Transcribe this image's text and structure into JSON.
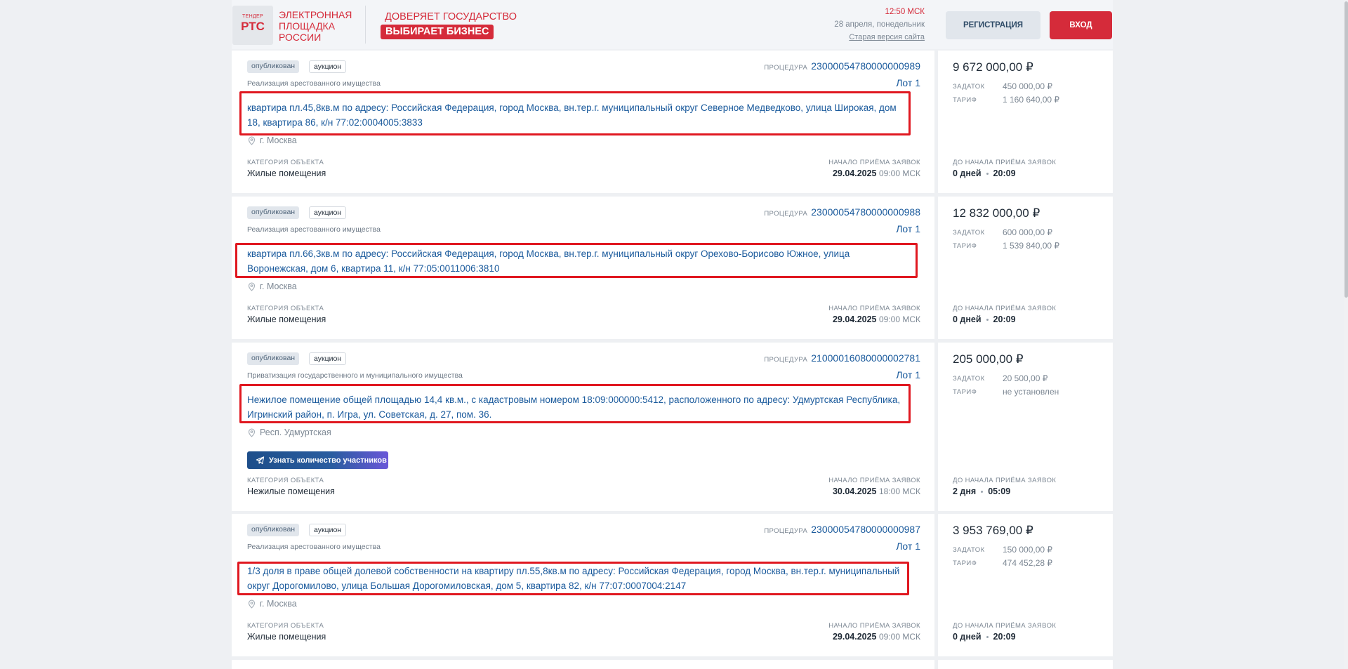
{
  "header": {
    "logo_small": "ТЕНДЕР",
    "logo_main": "РТС",
    "brand_lines": [
      "ЭЛЕКТРОННАЯ",
      "ПЛОЩАДКА",
      "РОССИИ"
    ],
    "slogan_top": "ДОВЕРЯЕТ ГОСУДАРСТВО",
    "slogan_bottom": "ВЫБИРАЕТ БИЗНЕС",
    "time": "12:50 МСК",
    "date": "28 апреля, понедельник",
    "old_version": "Старая версия сайта",
    "register_label": "РЕГИСТРАЦИЯ",
    "login_label": "ВХОД"
  },
  "labels": {
    "procedure": "ПРОЦЕДУРА",
    "category": "КАТЕГОРИЯ ОБЪЕКТА",
    "start": "НАЧАЛО ПРИЁМА ЗАЯВОК",
    "deposit": "ЗАДАТОК",
    "tariff": "ТАРИФ",
    "countdown": "ДО НАЧАЛА ПРИЁМА ЗАЯВОК",
    "participants_button": "Узнать количество участников"
  },
  "lots": [
    {
      "status": "опубликован",
      "type": "аукцион",
      "section": "Реализация арестованного имущества",
      "procedure": "23000054780000000989",
      "lot": "Лот 1",
      "title": "квартира пл.45,8кв.м по адресу: Российская Федерация, город Москва, вн.тер.г. муниципальный округ Северное Медведково, улица Широкая, дом 18, квартира 86, к/н 77:02:0004005:3833",
      "region": "г. Москва",
      "category": "Жилые помещения",
      "start_date": "29.04.2025",
      "start_time": "09:00 МСК",
      "price": "9 672 000,00 ₽",
      "deposit": "450 000,00 ₽",
      "tariff": "1 160 640,00 ₽",
      "countdown_days": "0 дней",
      "countdown_time": "20:09"
    },
    {
      "status": "опубликован",
      "type": "аукцион",
      "section": "Реализация арестованного имущества",
      "procedure": "23000054780000000988",
      "lot": "Лот 1",
      "title": "квартира пл.66,3кв.м по адресу: Российская Федерация, город Москва, вн.тер.г. муниципальный округ Орехово-Борисово Южное, улица Воронежская, дом 6, квартира 11, к/н 77:05:0011006:3810",
      "region": "г. Москва",
      "category": "Жилые помещения",
      "start_date": "29.04.2025",
      "start_time": "09:00 МСК",
      "price": "12 832 000,00 ₽",
      "deposit": "600 000,00 ₽",
      "tariff": "1 539 840,00 ₽",
      "countdown_days": "0 дней",
      "countdown_time": "20:09"
    },
    {
      "status": "опубликован",
      "type": "аукцион",
      "section": "Приватизация государственного и муниципального имущества",
      "procedure": "21000016080000002781",
      "lot": "Лот 1",
      "title": "Нежилое помещение общей площадью 14,4 кв.м., с кадастровым номером 18:09:000000:5412, расположенного по адресу: Удмуртская Республика, Игринский район, п. Игра, ул. Советская, д. 27, пом. 36.",
      "region": "Респ. Удмуртская",
      "category": "Нежилые помещения",
      "start_date": "30.04.2025",
      "start_time": "18:00 МСК",
      "price": "205 000,00 ₽",
      "deposit": "20 500,00 ₽",
      "tariff": "не установлен",
      "countdown_days": "2 дня",
      "countdown_time": "05:09"
    },
    {
      "status": "опубликован",
      "type": "аукцион",
      "section": "Реализация арестованного имущества",
      "procedure": "23000054780000000987",
      "lot": "Лот 1",
      "title": "1/3 доля в праве общей долевой собственности на квартиру пл.55,8кв.м по адресу: Российская Федерация, город Москва, вн.тер.г. муниципальный округ Дорогомилово, улица Большая Дорогомиловская, дом 5, квартира 82, к/н 77:07:0007004:2147",
      "region": "г. Москва",
      "category": "Жилые помещения",
      "start_date": "29.04.2025",
      "start_time": "09:00 МСК",
      "price": "3 953 769,00 ₽",
      "deposit": "150 000,00 ₽",
      "tariff": "474 452,28 ₽",
      "countdown_days": "0 дней",
      "countdown_time": "20:09"
    }
  ],
  "colors": {
    "brand_red": "#d52b3a",
    "link_blue": "#1a5a9c",
    "highlight_red": "#e01820"
  }
}
